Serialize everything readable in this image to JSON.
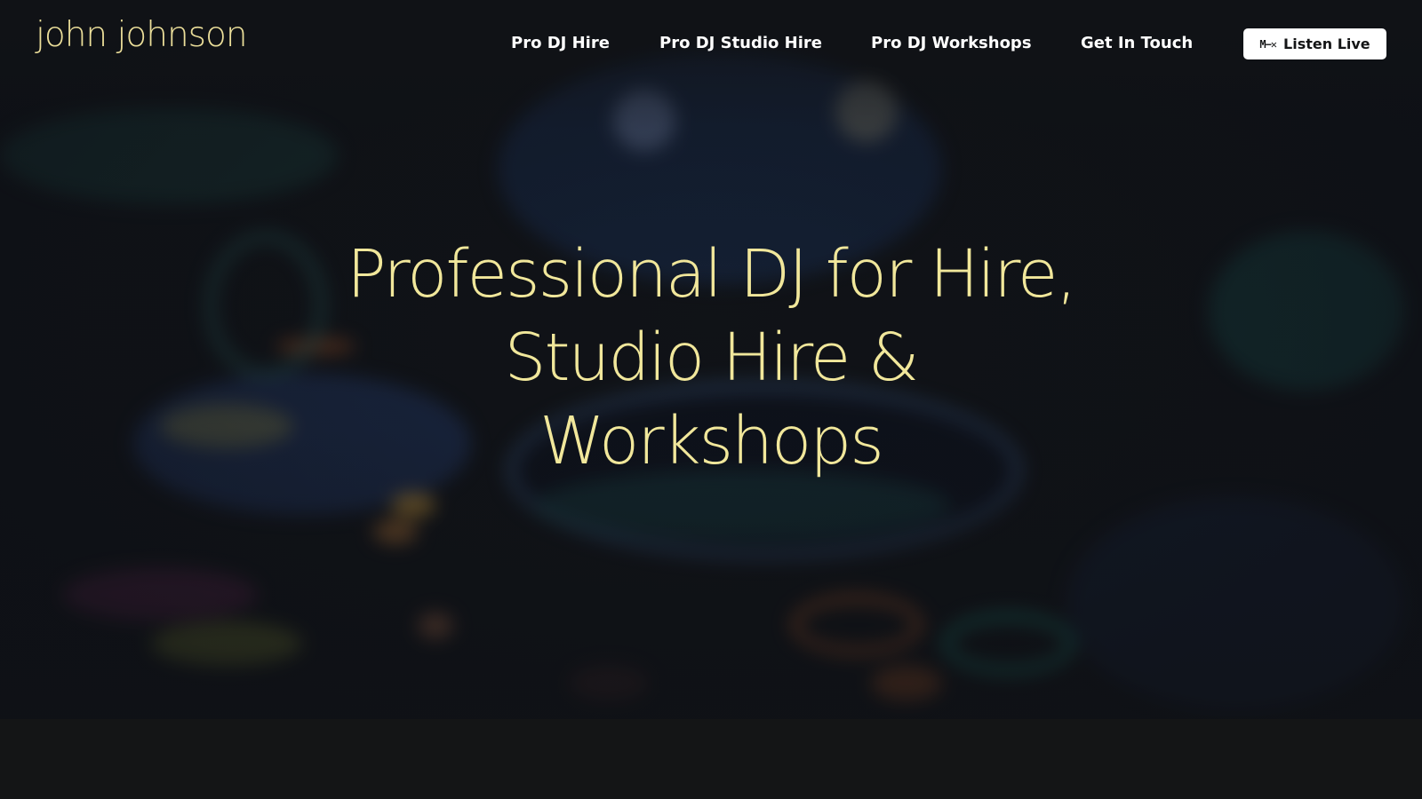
{
  "header": {
    "logo_text": "john johnson",
    "nav": [
      {
        "label": "Pro DJ Hire"
      },
      {
        "label": "Pro DJ Studio Hire"
      },
      {
        "label": "Pro DJ Workshops"
      },
      {
        "label": "Get In Touch"
      }
    ],
    "listen_button": {
      "icon_glyph": "M−✕",
      "icon_name": "mixcloud-icon",
      "label": "Listen Live"
    }
  },
  "hero": {
    "headline_lines": [
      "Professional DJ for Hire,",
      "Studio Hire &",
      "Workshops"
    ]
  },
  "colors": {
    "accent_gold": "#f1e79b",
    "background": "#141516",
    "nav_text": "#ffffff",
    "button_bg": "#ffffff"
  }
}
